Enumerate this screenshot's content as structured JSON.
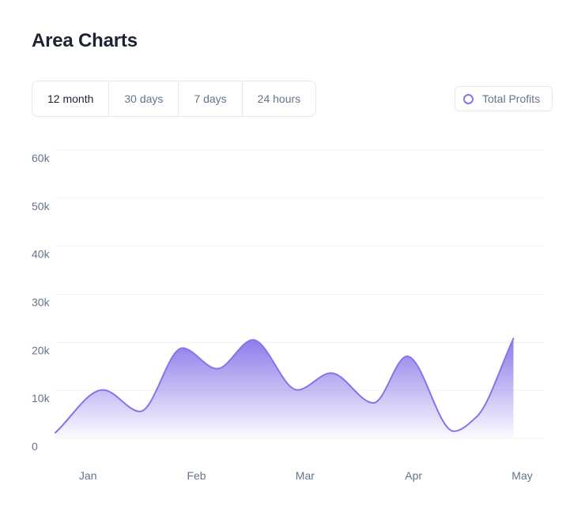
{
  "title": "Area Charts",
  "tabs": [
    {
      "label": "12 month",
      "active": true
    },
    {
      "label": "30 days",
      "active": false
    },
    {
      "label": "7 days",
      "active": false
    },
    {
      "label": "24 hours",
      "active": false
    }
  ],
  "legend": {
    "label": "Total Profits",
    "color": "#8674e8"
  },
  "colors": {
    "line": "#8674e8",
    "fill_top": "#8674e8",
    "grid": "#eef1f5",
    "text": "#64748b"
  },
  "chart_data": {
    "type": "area",
    "title": "",
    "xlabel": "",
    "ylabel": "",
    "grid": true,
    "legend_position": "top-right",
    "ylim": [
      0,
      60000
    ],
    "y_ticks": [
      {
        "value": 60000,
        "label": "60k"
      },
      {
        "value": 50000,
        "label": "50k"
      },
      {
        "value": 40000,
        "label": "40k"
      },
      {
        "value": 30000,
        "label": "30k"
      },
      {
        "value": 20000,
        "label": "20k"
      },
      {
        "value": 10000,
        "label": "10k"
      },
      {
        "value": 0,
        "label": "0"
      }
    ],
    "xlim": [
      0.7,
      5.2
    ],
    "x_ticks": [
      {
        "value": 1,
        "label": "Jan"
      },
      {
        "value": 2,
        "label": "Feb"
      },
      {
        "value": 3,
        "label": "Mar"
      },
      {
        "value": 4,
        "label": "Apr"
      },
      {
        "value": 5,
        "label": "May"
      }
    ],
    "series": [
      {
        "name": "Total Profits",
        "points": [
          {
            "x": 0.7,
            "y": 1200
          },
          {
            "x": 1.14,
            "y": 10100
          },
          {
            "x": 1.48,
            "y": 5600
          },
          {
            "x": 1.87,
            "y": 18800
          },
          {
            "x": 2.19,
            "y": 14500
          },
          {
            "x": 2.52,
            "y": 20500
          },
          {
            "x": 2.93,
            "y": 10100
          },
          {
            "x": 3.24,
            "y": 13600
          },
          {
            "x": 3.63,
            "y": 7400
          },
          {
            "x": 3.94,
            "y": 17100
          },
          {
            "x": 4.37,
            "y": 1500
          },
          {
            "x": 4.58,
            "y": 4500
          },
          {
            "x": 4.92,
            "y": 20800
          }
        ]
      }
    ]
  }
}
